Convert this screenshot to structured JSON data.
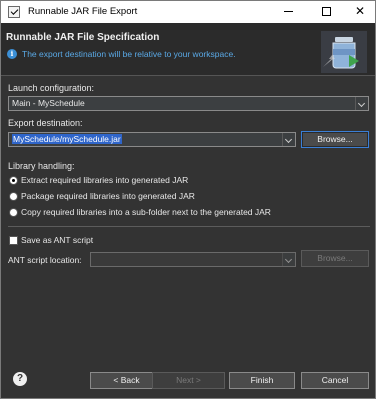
{
  "window": {
    "title": "Runnable JAR File Export",
    "minimize_glyph": "—",
    "close_glyph": "✕"
  },
  "header": {
    "title": "Runnable JAR File Specification",
    "message": "The export destination will be relative to your workspace.",
    "info_icon": "i"
  },
  "launch": {
    "label": "Launch configuration:",
    "value": "Main - MySchedule"
  },
  "export": {
    "label": "Export destination:",
    "value": "MySchedule/mySchedule.jar",
    "browse_label": "Browse..."
  },
  "library": {
    "label": "Library handling:",
    "options": [
      {
        "label": "Extract required libraries into generated JAR",
        "selected": true
      },
      {
        "label": "Package required libraries into generated JAR",
        "selected": false
      },
      {
        "label": "Copy required libraries into a sub-folder next to the generated JAR",
        "selected": false
      }
    ]
  },
  "ant": {
    "checkbox_label": "Save as ANT script",
    "checked": false,
    "location_label": "ANT script location:",
    "location_value": "",
    "browse_label": "Browse..."
  },
  "footer": {
    "help_icon": "?",
    "back_label": "< Back",
    "next_label": "Next >",
    "finish_label": "Finish",
    "cancel_label": "Cancel"
  },
  "colors": {
    "background": "#333333",
    "header_bg": "#2b2b2b",
    "info_text": "#5aa9e6",
    "selection": "#2f65ca",
    "focus_border": "#3b7fd6"
  }
}
